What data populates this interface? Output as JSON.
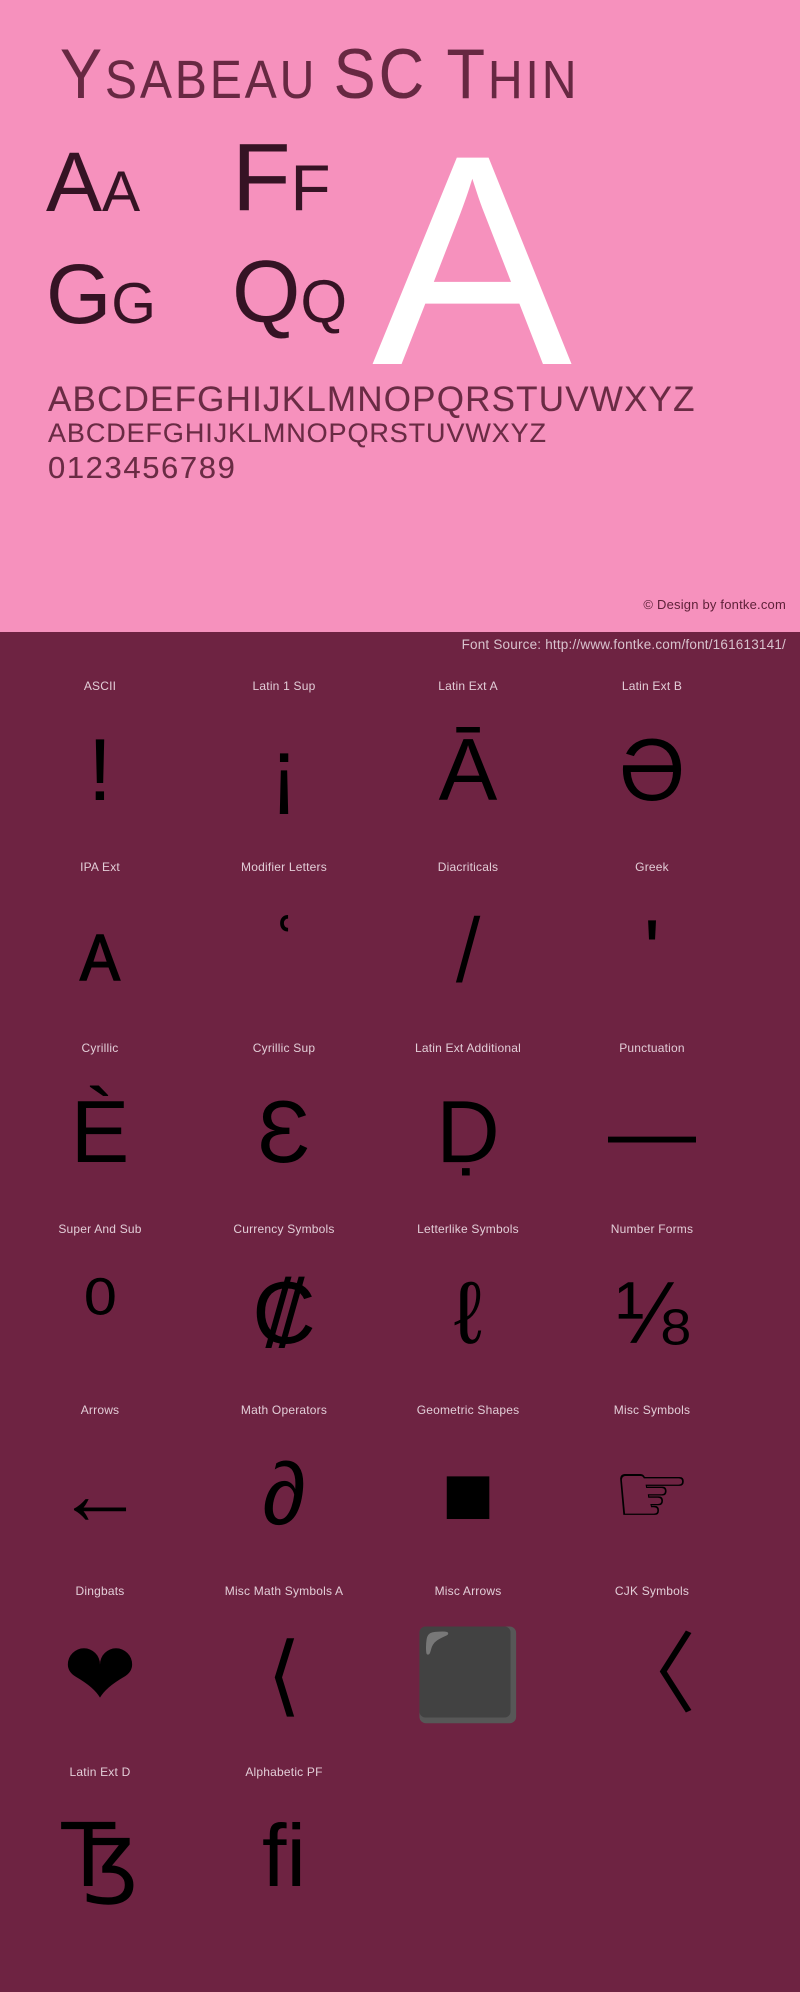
{
  "specimen": {
    "title_main": "Y",
    "title": "Ysabeau SC Thin",
    "title_parts": {
      "lead": "Y",
      "rest": "SABEAU ",
      "mid": "SC T",
      "tail": "HIN"
    },
    "pairs": [
      {
        "name": "pair-aa",
        "upper": "A",
        "small": "A"
      },
      {
        "name": "pair-ff",
        "upper": "F",
        "small": "F"
      },
      {
        "name": "pair-gg",
        "upper": "G",
        "small": "G"
      },
      {
        "name": "pair-qq",
        "upper": "Q",
        "small": "Q"
      }
    ],
    "big_letter": "A",
    "alphabet_upper": "ABCDEFGHIJKLMNOPQRSTUVWXYZ",
    "alphabet_small": "ABCDEFGHIJKLMNOPQRSTUVWXYZ",
    "digits": "0123456789",
    "design_credit": "© Design by fontke.com",
    "source_text": "Font Source: http://www.fontke.com/font/161613141/",
    "colors": {
      "panel_bg": "#f691bd",
      "grid_bg": "#6e2342",
      "ink": "#2b0d1c",
      "big_letter": "#ffffff",
      "label": "#e2cdd7"
    }
  },
  "glyph_grid": {
    "rows": [
      [
        {
          "label": "ASCII",
          "glyph": "!"
        },
        {
          "label": "Latin 1 Sup",
          "glyph": "¡"
        },
        {
          "label": "Latin Ext A",
          "glyph": "Ā"
        },
        {
          "label": "Latin Ext B",
          "glyph": "Ə"
        }
      ],
      [
        {
          "label": "IPA Ext",
          "glyph": "ᴀ"
        },
        {
          "label": "Modifier Letters",
          "glyph": "ʿ"
        },
        {
          "label": "Diacriticals",
          "glyph": "̸"
        },
        {
          "label": "Greek",
          "glyph": "ʹ"
        }
      ],
      [
        {
          "label": "Cyrillic",
          "glyph": "Ѐ"
        },
        {
          "label": "Cyrillic Sup",
          "glyph": "Ɛ"
        },
        {
          "label": "Latin Ext Additional",
          "glyph": "Ḍ"
        },
        {
          "label": "Punctuation",
          "glyph": "—"
        }
      ],
      [
        {
          "label": "Super And Sub",
          "glyph": "⁰"
        },
        {
          "label": "Currency Symbols",
          "glyph": "₡"
        },
        {
          "label": "Letterlike Symbols",
          "glyph": "ℓ"
        },
        {
          "label": "Number Forms",
          "glyph": "⅛"
        }
      ],
      [
        {
          "label": "Arrows",
          "glyph": "←"
        },
        {
          "label": "Math Operators",
          "glyph": "∂"
        },
        {
          "label": "Geometric Shapes",
          "glyph": "■"
        },
        {
          "label": "Misc Symbols",
          "glyph": "☞"
        }
      ],
      [
        {
          "label": "Dingbats",
          "glyph": "❤"
        },
        {
          "label": "Misc Math Symbols A",
          "glyph": "⟨"
        },
        {
          "label": "Misc Arrows",
          "glyph": "⬛"
        },
        {
          "label": "CJK Symbols",
          "glyph": "〈"
        }
      ],
      [
        {
          "label": "Latin Ext D",
          "glyph": "Ꜩ"
        },
        {
          "label": "Alphabetic PF",
          "glyph": "ﬁ"
        }
      ]
    ]
  }
}
